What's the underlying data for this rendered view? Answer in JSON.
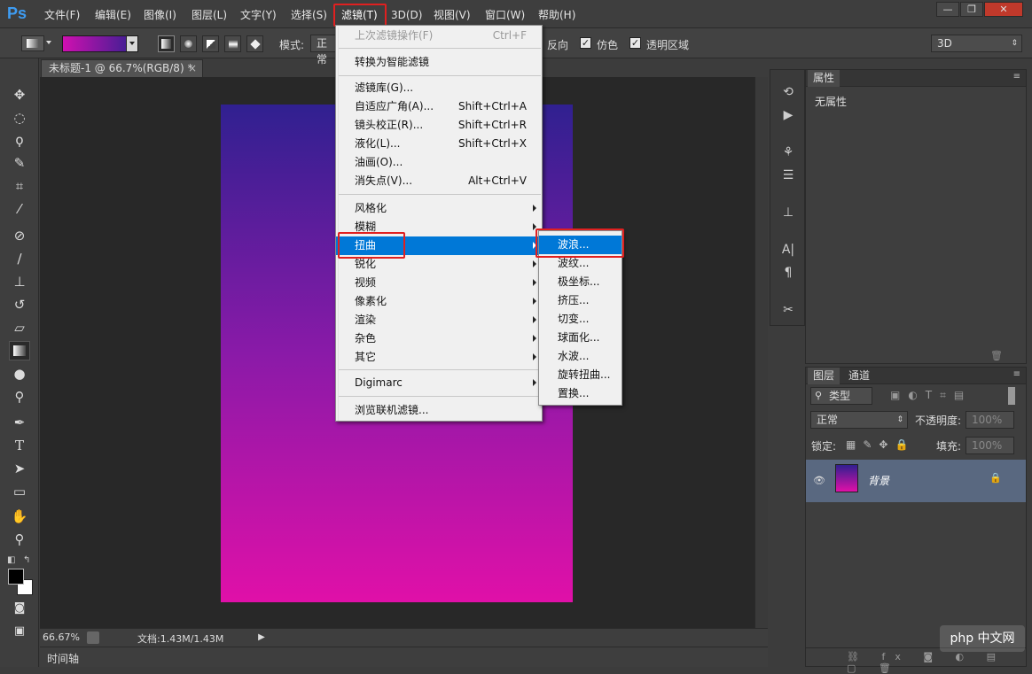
{
  "app": {
    "logo": "Ps"
  },
  "menubar": {
    "items": [
      "文件(F)",
      "编辑(E)",
      "图像(I)",
      "图层(L)",
      "文字(Y)",
      "选择(S)",
      "滤镜(T)",
      "3D(D)",
      "视图(V)",
      "窗口(W)",
      "帮助(H)"
    ],
    "active": "滤镜(T)"
  },
  "window_controls": {
    "minimize": "—",
    "restore": "❐",
    "close": "✕"
  },
  "options": {
    "mode_label": "模式:",
    "mode_value": "正常",
    "reverse_label": "反向",
    "dither_label": "仿色",
    "transparency_label": "透明区域",
    "workspace": "3D"
  },
  "document": {
    "tab_title": "未标题-1 @ 66.7%(RGB/8) *",
    "zoom": "66.67%",
    "doc_size": "文档:1.43M/1.43M",
    "timeline": "时间轴"
  },
  "filter_menu": {
    "items": [
      {
        "label": "上次滤镜操作(F)",
        "shortcut": "Ctrl+F",
        "disabled": true
      },
      {
        "label": "转换为智能滤镜",
        "shortcut": ""
      },
      {
        "label": "滤镜库(G)...",
        "shortcut": ""
      },
      {
        "label": "自适应广角(A)...",
        "shortcut": "Shift+Ctrl+A"
      },
      {
        "label": "镜头校正(R)...",
        "shortcut": "Shift+Ctrl+R"
      },
      {
        "label": "液化(L)...",
        "shortcut": "Shift+Ctrl+X"
      },
      {
        "label": "油画(O)...",
        "shortcut": ""
      },
      {
        "label": "消失点(V)...",
        "shortcut": "Alt+Ctrl+V"
      },
      {
        "label": "风格化",
        "submenu": true
      },
      {
        "label": "模糊",
        "submenu": true
      },
      {
        "label": "扭曲",
        "submenu": true,
        "highlighted": true
      },
      {
        "label": "锐化",
        "submenu": true
      },
      {
        "label": "视频",
        "submenu": true
      },
      {
        "label": "像素化",
        "submenu": true
      },
      {
        "label": "渲染",
        "submenu": true
      },
      {
        "label": "杂色",
        "submenu": true
      },
      {
        "label": "其它",
        "submenu": true
      },
      {
        "label": "Digimarc",
        "submenu": true
      },
      {
        "label": "浏览联机滤镜...",
        "shortcut": ""
      }
    ]
  },
  "distort_submenu": {
    "items": [
      "波浪...",
      "波纹...",
      "极坐标...",
      "挤压...",
      "切变...",
      "球面化...",
      "水波...",
      "旋转扭曲...",
      "置换..."
    ],
    "highlighted": "波浪..."
  },
  "properties_panel": {
    "tab": "属性",
    "content": "无属性"
  },
  "layers_panel": {
    "tabs": [
      "图层",
      "通道"
    ],
    "filter": "类型",
    "blend_mode": "正常",
    "opacity_label": "不透明度:",
    "opacity_value": "100%",
    "lock_label": "锁定:",
    "fill_label": "填充:",
    "fill_value": "100%",
    "layer_name": "背景"
  },
  "watermark": "php 中文网",
  "colors": {
    "accent_highlight": "#0078d7",
    "red_box": "#e02020"
  }
}
